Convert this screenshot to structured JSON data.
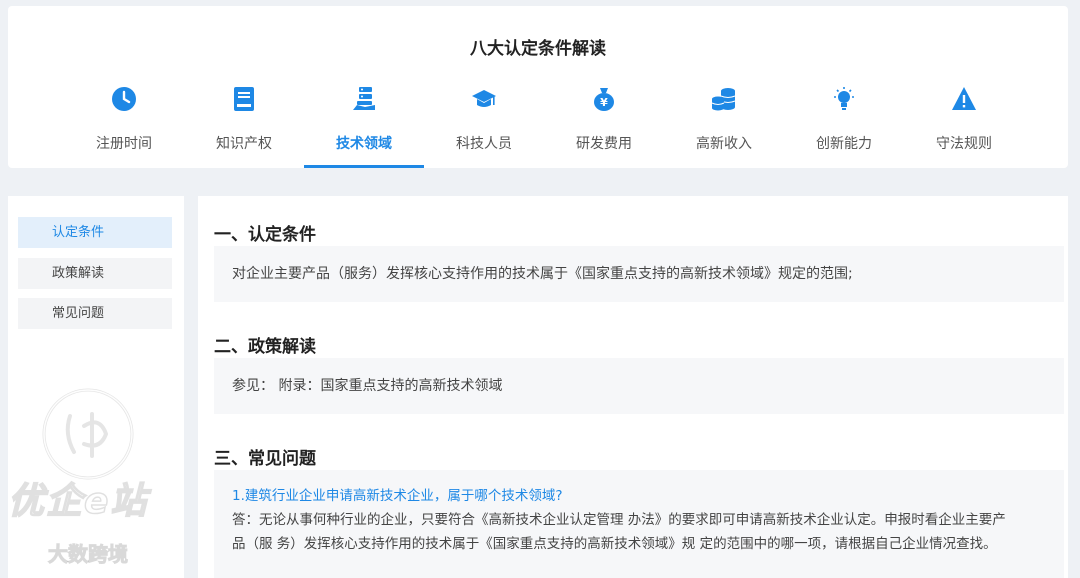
{
  "header": {
    "title": "八大认定条件解读"
  },
  "tabs": [
    {
      "label": "注册时间",
      "icon": "clock-icon"
    },
    {
      "label": "知识产权",
      "icon": "book-icon"
    },
    {
      "label": "技术领域",
      "icon": "stack-hand-icon",
      "active": true
    },
    {
      "label": "科技人员",
      "icon": "graduation-cap-icon"
    },
    {
      "label": "研发费用",
      "icon": "money-bag-icon"
    },
    {
      "label": "高新收入",
      "icon": "coins-icon"
    },
    {
      "label": "创新能力",
      "icon": "lightbulb-icon"
    },
    {
      "label": "守法规则",
      "icon": "warning-icon"
    }
  ],
  "sidebar": {
    "items": [
      {
        "label": "认定条件",
        "active": true
      },
      {
        "label": "政策解读"
      },
      {
        "label": "常见问题"
      }
    ]
  },
  "watermark": {
    "text1": "优企e站",
    "text2": "大数跨境"
  },
  "sections": [
    {
      "title": "一、认定条件",
      "body": "对企业主要产品（服务）发挥核心支持作用的技术属于《国家重点支持的高新技术领域》规定的范围;"
    },
    {
      "title": "二、政策解读",
      "body": "参见： 附录：国家重点支持的高新技术领域"
    },
    {
      "title": "三、常见问题",
      "question": "1.建筑行业企业申请高新技术企业，属于哪个技术领域?",
      "answer_line1": "答：无论从事何种行业的企业，只要符合《高新技术企业认定管理 办法》的要求即可申请高新技术企业认定。申报时看企业主要产",
      "answer_line2": "品（服 务）发挥核心支持作用的技术属于《国家重点支持的高新技术领域》规 定的范围中的哪一项，请根据自己企业情况查找。"
    }
  ],
  "colors": {
    "accent": "#1e88e5",
    "icon_blue": "#1e88e5"
  }
}
